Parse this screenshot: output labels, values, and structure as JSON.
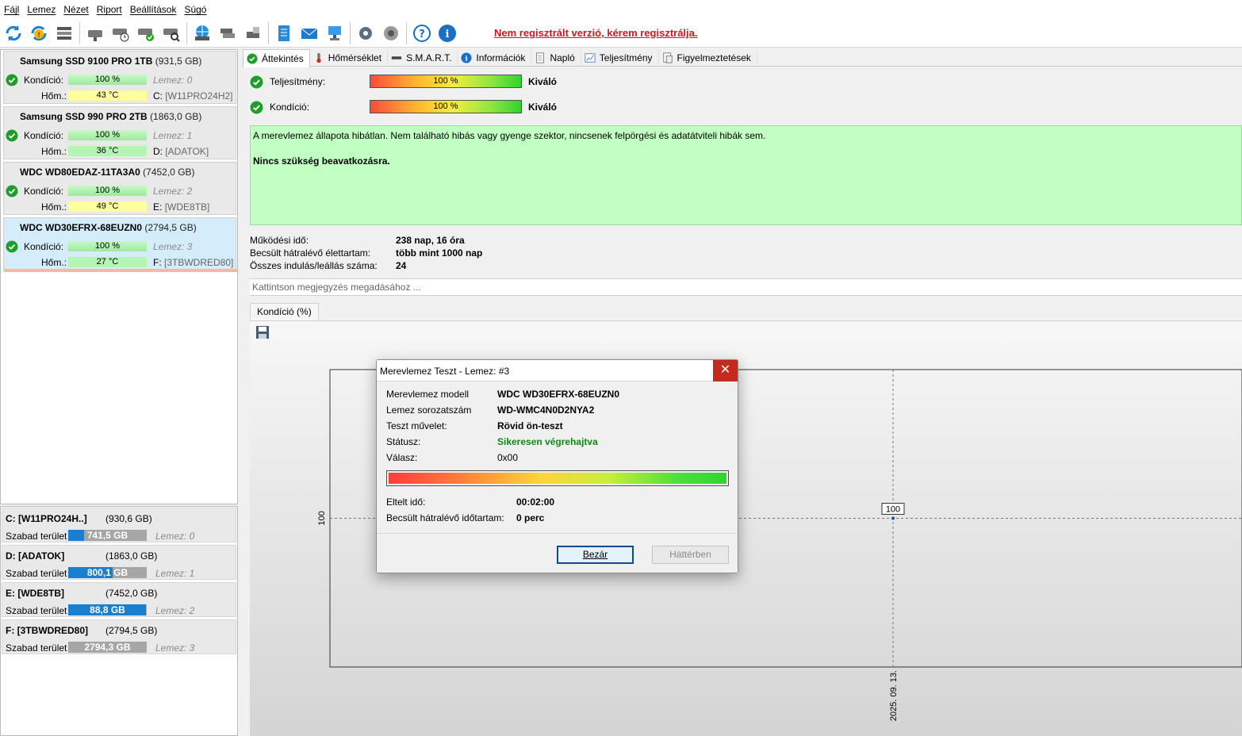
{
  "menu": [
    "Fájl",
    "Lemez",
    "Nézet",
    "Riport",
    "Beállítások",
    "Súgó"
  ],
  "toolbar": {
    "register_link": "Nem regisztrált verzió, kérem regisztrálja."
  },
  "disks": [
    {
      "name": "Samsung SSD 9100 PRO 1TB",
      "size": "(931,5 GB)",
      "kondicio_label": "Kondíció:",
      "kondicio": "100 %",
      "hom_label": "Hőm.:",
      "hom": "43 °C",
      "lemez": "Lemez: 0",
      "drive": "C:",
      "drive_label": "[W11PRO24H2]",
      "temp_color": "#ffff9e"
    },
    {
      "name": "Samsung SSD 990 PRO 2TB",
      "size": "(1863,0 GB)",
      "kondicio_label": "Kondíció:",
      "kondicio": "100 %",
      "hom_label": "Hőm.:",
      "hom": "36 °C",
      "lemez": "Lemez: 1",
      "drive": "D:",
      "drive_label": "[ADATOK]",
      "temp_color": "#b4f5b4"
    },
    {
      "name": "WDC WD80EDAZ-11TA3A0",
      "size": "(7452,0 GB)",
      "kondicio_label": "Kondíció:",
      "kondicio": "100 %",
      "hom_label": "Hőm.:",
      "hom": "49 °C",
      "lemez": "Lemez: 2",
      "drive": "E:",
      "drive_label": "[WDE8TB]",
      "temp_color": "#ffff9e"
    },
    {
      "name": "WDC WD30EFRX-68EUZN0",
      "size": "(2794,5 GB)",
      "kondicio_label": "Kondíció:",
      "kondicio": "100 %",
      "hom_label": "Hőm.:",
      "hom": "27 °C",
      "lemez": "Lemez: 3",
      "drive": "F:",
      "drive_label": "[3TBWDRED80]",
      "temp_color": "#b4f5b4"
    }
  ],
  "volumes": [
    {
      "name": "C: [W11PRO24H..]",
      "size": "(930,6 GB)",
      "free_label": "Szabad terület",
      "free": "741,5 GB",
      "free_fraction": 0.2,
      "lemez": "Lemez: 0"
    },
    {
      "name": "D: [ADATOK]",
      "size": "(1863,0 GB)",
      "free_label": "Szabad terület",
      "free": "800,1 GB",
      "free_fraction": 0.57,
      "lemez": "Lemez: 1"
    },
    {
      "name": "E: [WDE8TB]",
      "size": "(7452,0 GB)",
      "free_label": "Szabad terület",
      "free": "88,8 GB",
      "free_fraction": 0.99,
      "lemez": "Lemez: 2"
    },
    {
      "name": "F: [3TBWDRED80]",
      "size": "(2794,5 GB)",
      "free_label": "Szabad terület",
      "free": "2794,3 GB",
      "free_fraction": 0.0,
      "lemez": "Lemez: 3"
    }
  ],
  "tabs": [
    "Áttekintés",
    "Hőmérséklet",
    "S.M.A.R.T.",
    "Információk",
    "Napló",
    "Teljesítmény",
    "Figyelmeztetések"
  ],
  "overview": {
    "perf_label": "Teljesítmény:",
    "perf_value": "100 %",
    "perf_result": "Kiváló",
    "cond_label": "Kondíció:",
    "cond_value": "100 %",
    "cond_result": "Kiváló",
    "status_text": "A merevlemez állapota hibátlan. Nem található hibás vagy gyenge szektor, nincsenek felpörgési és adatátviteli hibák sem.",
    "status_action": "Nincs szükség beavatkozásra.",
    "uptime_label": "Működési idő:",
    "uptime": "238 nap, 16 óra",
    "remaining_label": "Becsült hátralévő élettartam:",
    "remaining": "több mint 1000 nap",
    "starts_label": "Összes indulás/leállás száma:",
    "starts": "24",
    "note_placeholder": "Kattintson megjegyzés megadásához ..."
  },
  "chart_tab": "Kondíció  (%)",
  "chart_data": {
    "type": "line",
    "x": [
      "2025. 09. 13."
    ],
    "series": [
      {
        "values": [
          100
        ]
      }
    ],
    "ytick": "100"
  },
  "dialog": {
    "title": "Merevlemez Teszt - Lemez: #3",
    "model_label": "Merevlemez modell",
    "model": "WDC WD30EFRX-68EUZN0",
    "serial_label": "Lemez sorozatszám",
    "serial": "WD-WMC4N0D2NYA2",
    "op_label": "Teszt művelet:",
    "op": "Rövid ön-teszt",
    "status_label": "Státusz:",
    "status": "Sikeresen végrehajtva",
    "reply_label": "Válasz:",
    "reply": "0x00",
    "progress": 1.0,
    "elapsed_label": "Eltelt idő:",
    "elapsed": "00:02:00",
    "remaining_label": "Becsült hátralévő időtartam:",
    "remaining": "0 perc",
    "close_button": "Bezár",
    "background_button": "Háttérben"
  }
}
